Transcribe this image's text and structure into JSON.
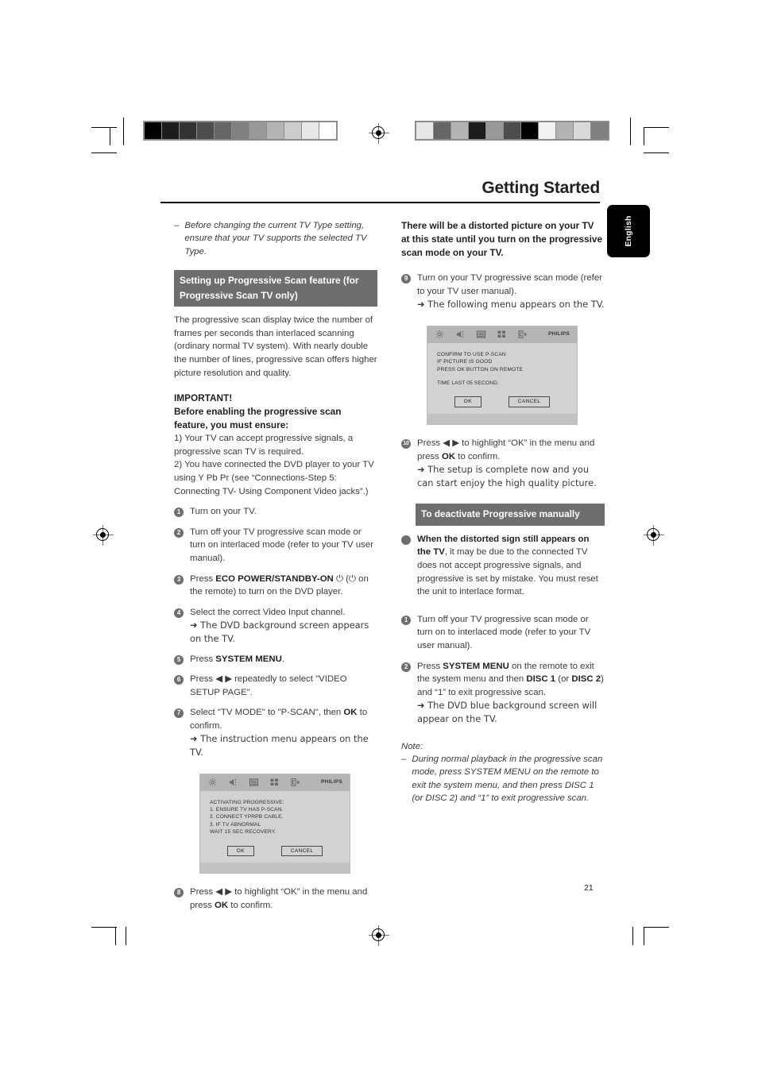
{
  "page": {
    "title": "Getting Started",
    "language_tab": "English",
    "page_number": "21"
  },
  "calibration": {
    "left_bar_swatches": [
      "#000000",
      "#1c1c1c",
      "#333333",
      "#4d4d4d",
      "#666666",
      "#808080",
      "#999999",
      "#b3b3b3",
      "#cccccc",
      "#e8e8e8",
      "#ffffff"
    ],
    "right_bar_swatches": [
      "#e8e8e8",
      "#666666",
      "#b3b3b3",
      "#1c1c1c",
      "#999999",
      "#4d4d4d",
      "#000000",
      "#f2f2f2",
      "#b3b3b3",
      "#d9d9d9",
      "#808080"
    ]
  },
  "left_column": {
    "note_dash": "–",
    "note_italic": "Before changing the current TV Type setting, ensure that your TV supports the selected TV Type.",
    "section_heading": "Setting up Progressive Scan feature (for Progressive Scan TV only)",
    "intro_paragraph": "The progressive scan display twice the number of frames per seconds than interlaced scanning (ordinary normal TV system). With nearly double the number of lines, progressive scan offers higher picture resolution and quality.",
    "important_label": "IMPORTANT!",
    "important_subhead": "Before enabling the progressive scan feature, you must ensure:",
    "requirement_1": "1) Your TV can accept progressive signals, a progressive scan TV is required.",
    "requirement_2": "2) You have connected the DVD player to your TV using Y Pb Pr (see “Connections-Step 5: Connecting TV- Using Component Video jacks”.)",
    "steps": [
      {
        "num": "1",
        "text": "Turn on your TV."
      },
      {
        "num": "2",
        "text": "Turn off your TV progressive scan mode or turn on interlaced mode (refer to your TV user manual)."
      },
      {
        "num": "3",
        "text_before": "Press ",
        "bold": "ECO POWER/STANDBY-ON",
        "text_after": " ⏻ (⏻ on the remote) to turn on the DVD player."
      },
      {
        "num": "4",
        "text": "Select the correct Video Input channel.",
        "arrow": "➜ The DVD background screen appears on the TV."
      },
      {
        "num": "5",
        "text_before": "Press ",
        "bold": "SYSTEM MENU",
        "text_after": "."
      },
      {
        "num": "6",
        "text": "Press ◀ ▶ repeatedly to select \"VIDEO SETUP PAGE\"."
      },
      {
        "num": "7",
        "text_before": "Select \"TV MODE\" to \"P-SCAN\", then ",
        "bold": "OK",
        "text_after": " to confirm.",
        "arrow": "➜ The instruction menu appears on the TV."
      },
      {
        "num": "8",
        "text_before": "Press ◀ ▶ to highlight “OK” in the menu and press ",
        "bold": "OK",
        "text_after": " to confirm."
      }
    ],
    "tv_screen": {
      "icons": [
        "gear-icon",
        "speaker-icon",
        "display-icon",
        "grid-icon",
        "exit-icon"
      ],
      "brand": "PHILIPS",
      "lines": [
        "ACTIVATING PROGRESSIVE:",
        "1. ENSURE TV HAS P-SCAN.",
        "2. CONNECT YPRPB CABLE.",
        "3. IF TV ABNORMAL",
        "WAIT 15 SEC RECOVERY."
      ],
      "ok_label": "OK",
      "cancel_label": "CANCEL"
    }
  },
  "right_column": {
    "warning": "There will be a distorted picture on your TV at this state until you turn on the progressive scan mode on your TV.",
    "step_9": {
      "num": "9",
      "text": "Turn on your TV progressive scan mode (refer to your TV user manual).",
      "arrow": "➜ The following menu appears on the TV."
    },
    "tv_screen": {
      "icons": [
        "gear-icon",
        "speaker-icon",
        "display-icon",
        "grid-icon",
        "exit-icon"
      ],
      "brand": "PHILIPS",
      "lines": [
        "CONFIRM TO USE P-SCAN",
        "IF PICTURE IS GOOD",
        "PRESS OK BUTTON ON REMOTE"
      ],
      "lines2": [
        "TIME LAST 05 SECOND."
      ],
      "ok_label": "OK",
      "cancel_label": "CANCEL"
    },
    "step_10": {
      "num": "10",
      "text_before": "Press ◀ ▶ to highlight “OK” in the menu and press ",
      "bold": "OK",
      "text_after": " to confirm.",
      "arrow": "➜ The setup is complete now and you can start enjoy the high quality picture."
    },
    "section_heading": "To deactivate Progressive manually",
    "bullet": {
      "bold": "When the distorted sign still appears on the TV",
      "text": ", it may be due to the connected TV does not accept progressive signals, and progressive is set by mistake. You must reset the unit to interlace format."
    },
    "steps": [
      {
        "num": "1",
        "text": "Turn off your TV progressive scan mode or turn on to interlaced mode (refer to your TV user manual)."
      }
    ],
    "step_2": {
      "num": "2",
      "t1": "Press ",
      "b1": "SYSTEM MENU",
      "t2": " on the remote to exit the system menu and then ",
      "b2": "DISC 1",
      "t3": " (or ",
      "b3": "DISC 2",
      "t4": ") and “1” to exit progressive scan.",
      "arrow": "➜ The DVD blue background screen will appear on the TV."
    },
    "note_label": "Note:",
    "note_dash": "–",
    "note_text": "During normal playback in the progressive scan mode, press SYSTEM MENU on the remote to exit the system menu, and then press DISC 1 (or DISC 2) and “1” to exit progressive scan."
  }
}
